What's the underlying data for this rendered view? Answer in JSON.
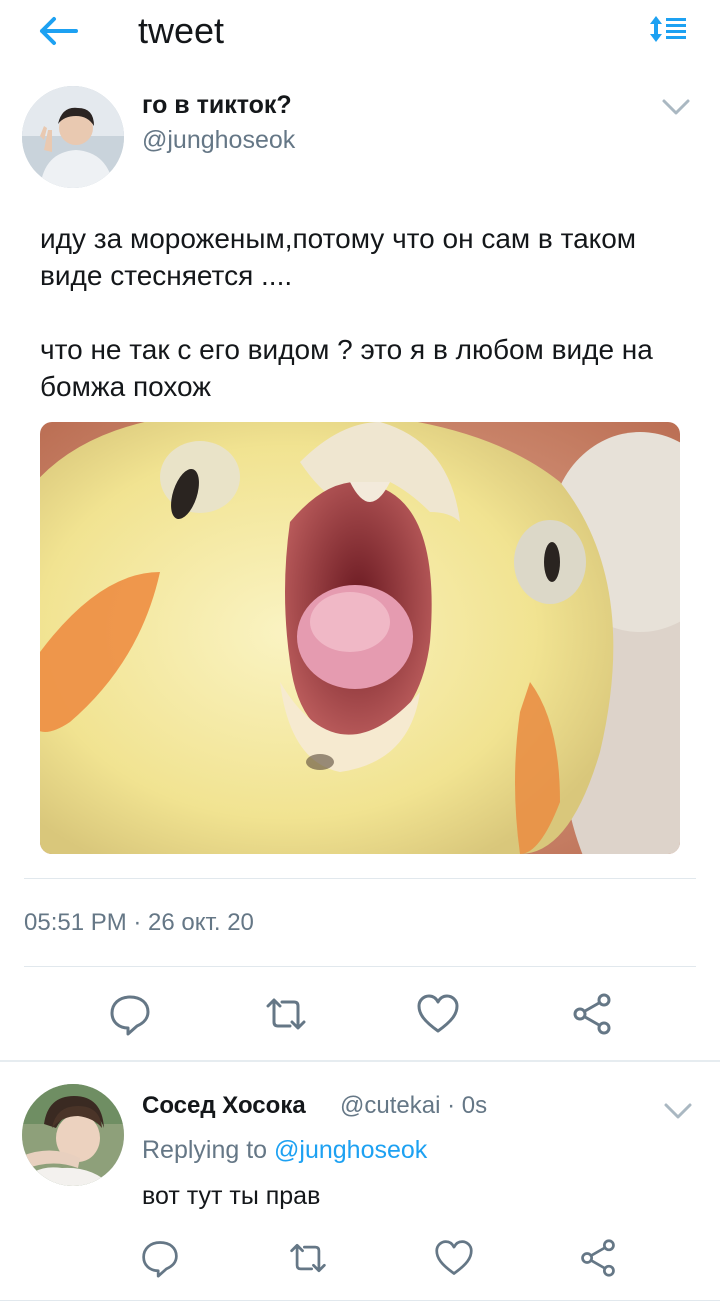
{
  "topbar": {
    "title": "tweet"
  },
  "tweet": {
    "author_name": "го в тикток?",
    "author_handle": "@junghoseok",
    "text_p1": "иду за мороженым,потому что он сам в таком виде стесняется ....",
    "text_p2": "что не так с его видом ? это я в любом виде на бомжа похож",
    "media_icon": "screaming-cockatiel-photo",
    "timestamp": "05:51 PM · 26 окт. 20"
  },
  "reply": {
    "author_name": "Сосед Хосока",
    "author_handle": "@cutekai · 0s",
    "replying_prefix": "Replying to",
    "replying_mention": "@junghoseok",
    "text": "вот тут ты прав"
  },
  "icons": {
    "back": "arrow-left-icon",
    "sort": "sort-arrows-icon",
    "menu": "chevron-down-icon",
    "reply": "speech-bubble-icon",
    "retweet": "retweet-icon",
    "like": "heart-icon",
    "share": "share-icon"
  },
  "colors": {
    "accent": "#1da1f2",
    "text": "#14171a",
    "muted": "#657786",
    "divider": "#e1e8ed"
  }
}
